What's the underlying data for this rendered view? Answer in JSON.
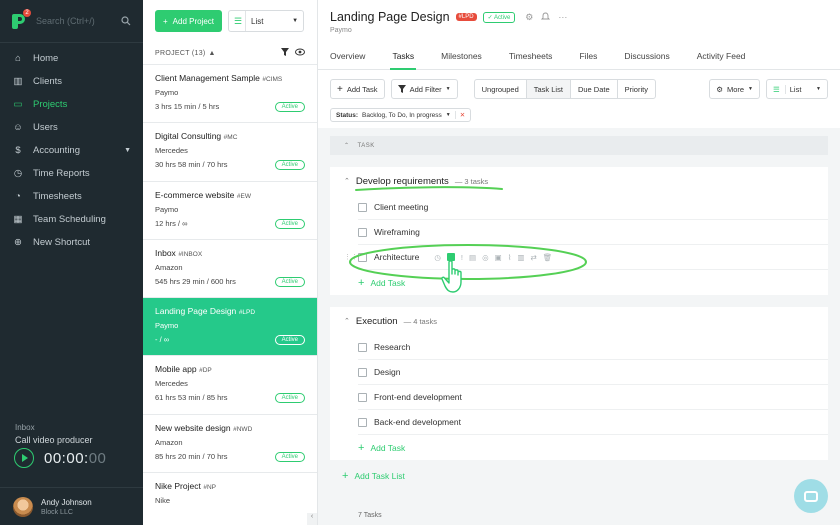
{
  "sidebar": {
    "logo_badge": "2",
    "search_placeholder": "Search (Ctrl+/)",
    "nav": [
      {
        "label": "Home",
        "icon": "home-icon"
      },
      {
        "label": "Clients",
        "icon": "clients-icon"
      },
      {
        "label": "Projects",
        "icon": "folder-icon",
        "active": true
      },
      {
        "label": "Users",
        "icon": "user-icon"
      },
      {
        "label": "Accounting",
        "icon": "accounting-icon",
        "has_caret": true
      },
      {
        "label": "Time Reports",
        "icon": "clock-icon"
      },
      {
        "label": "Timesheets",
        "icon": "timesheet-icon"
      },
      {
        "label": "Team Scheduling",
        "icon": "calendar-icon"
      },
      {
        "label": "New Shortcut",
        "icon": "plus-circle-icon"
      }
    ],
    "inbox_label": "Inbox",
    "inbox_title": "Call video producer",
    "timer": {
      "main": "00:00:",
      "dim": "00"
    },
    "user": {
      "name": "Andy Johnson",
      "org": "Block LLC"
    }
  },
  "project_list": {
    "add_button": "Add Project",
    "view_select": "List",
    "header": "PROJECT (13)",
    "projects": [
      {
        "name": "Client Management Sample",
        "code": "#CIMS",
        "client": "Paymo",
        "hours": "3 hrs 15 min / 5 hrs",
        "status": "Active"
      },
      {
        "name": "Digital Consulting",
        "code": "#MC",
        "client": "Mercedes",
        "hours": "30 hrs 58 min / 70 hrs",
        "status": "Active"
      },
      {
        "name": "E-commerce website",
        "code": "#EW",
        "client": "Paymo",
        "hours": "12 hrs / ∞",
        "status": "Active"
      },
      {
        "name": "Inbox",
        "code": "#INBOX",
        "client": "Amazon",
        "hours": "545 hrs 29 min / 600 hrs",
        "status": "Active"
      },
      {
        "name": "Landing Page Design",
        "code": "#LPD",
        "client": "Paymo",
        "hours": "- / ∞",
        "status": "Active",
        "selected": true
      },
      {
        "name": "Mobile app",
        "code": "#DP",
        "client": "Mercedes",
        "hours": "61 hrs 53 min / 85 hrs",
        "status": "Active"
      },
      {
        "name": "New website design",
        "code": "#NWD",
        "client": "Amazon",
        "hours": "85 hrs 20 min / 70 hrs",
        "status": "Active"
      },
      {
        "name": "Nike Project",
        "code": "#NP",
        "client": "Nike",
        "hours": "",
        "status": ""
      }
    ]
  },
  "main": {
    "title": "Landing Page Design",
    "code": "#LPD",
    "status": "Active",
    "client": "Paymo",
    "tabs": [
      "Overview",
      "Tasks",
      "Milestones",
      "Timesheets",
      "Files",
      "Discussions",
      "Activity Feed"
    ],
    "active_tab": "Tasks",
    "toolbar": {
      "add_task": "Add Task",
      "add_filter": "Add Filter",
      "groupings": [
        "Ungrouped",
        "Task List",
        "Due Date",
        "Priority"
      ],
      "active_grouping": "Task List",
      "more": "More",
      "view": "List"
    },
    "filter": {
      "label": "Status:",
      "value": "Backlog, To Do, In progress"
    },
    "column_header": "TASK",
    "task_lists": [
      {
        "name": "Develop requirements",
        "count": "— 3 tasks",
        "tasks": [
          "Client meeting",
          "Wireframing",
          "Architecture"
        ],
        "add_label": "Add Task"
      },
      {
        "name": "Execution",
        "count": "— 4 tasks",
        "tasks": [
          "Research",
          "Design",
          "Front-end development",
          "Back-end development"
        ],
        "add_label": "Add Task"
      }
    ],
    "add_task_list": "Add Task List",
    "footer_count": "7 Tasks"
  },
  "colors": {
    "accent": "#2ecc71",
    "sidebar_bg": "#1f2a30",
    "selected_card": "#25c98a",
    "code_pill": "#e74c3c"
  }
}
